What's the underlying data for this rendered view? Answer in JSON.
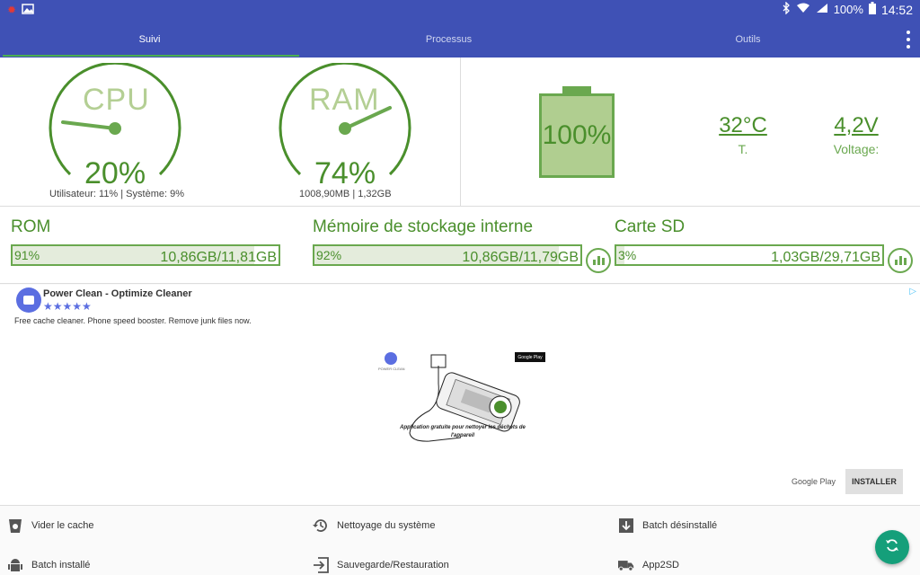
{
  "status": {
    "battery_pct": "100%",
    "time": "14:52"
  },
  "tabs": [
    {
      "label": "Suivi",
      "active": true
    },
    {
      "label": "Processus",
      "active": false
    },
    {
      "label": "Outils",
      "active": false
    }
  ],
  "cpu": {
    "label": "CPU",
    "value": "20%",
    "value_fraction": 0.2,
    "detail": "Utilisateur: 11% | Système: 9%"
  },
  "ram": {
    "label": "RAM",
    "value": "74%",
    "value_fraction": 0.74,
    "detail": "1008,90MB | 1,32GB"
  },
  "battery": {
    "level": "100%",
    "level_fraction": 1.0,
    "temperature": "32°C",
    "temperature_label": "T.",
    "voltage": "4,2V",
    "voltage_label": "Voltage:"
  },
  "storage": [
    {
      "title": "ROM",
      "percent": "91%",
      "fraction": 0.91,
      "size": "10,86GB/11,81GB",
      "has_chart": false
    },
    {
      "title": "Mémoire de stockage interne",
      "percent": "92%",
      "fraction": 0.92,
      "size": "10,86GB/11,79GB",
      "has_chart": true
    },
    {
      "title": "Carte SD",
      "percent": "3%",
      "fraction": 0.03,
      "size": "1,03GB/29,71GB",
      "has_chart": true
    }
  ],
  "ad": {
    "title": "Power Clean - Optimize Cleaner",
    "rating": 4.5,
    "stars": "★★★★★",
    "description": "Free cache cleaner. Phone speed booster. Remove junk files now.",
    "image_caption": "Application gratuite pour nettoyer les déchets de l'appareil",
    "brand_text": "POWER CLEAN",
    "play_badge": "Google Play",
    "store_label": "Google Play",
    "install_label": "INSTALLER"
  },
  "tools": [
    {
      "label": "Vider le cache",
      "icon": "trash-icon"
    },
    {
      "label": "Nettoyage du système",
      "icon": "history-icon"
    },
    {
      "label": "Batch désinstallé",
      "icon": "uninstall-icon"
    },
    {
      "label": "Batch installé",
      "icon": "android-icon"
    },
    {
      "label": "Sauvegarde/Restauration",
      "icon": "backup-icon"
    },
    {
      "label": "App2SD",
      "icon": "truck-icon"
    }
  ],
  "colors": {
    "primary": "#3f51b5",
    "accent_green": "#4a8f2c",
    "fab": "#159f7a"
  }
}
